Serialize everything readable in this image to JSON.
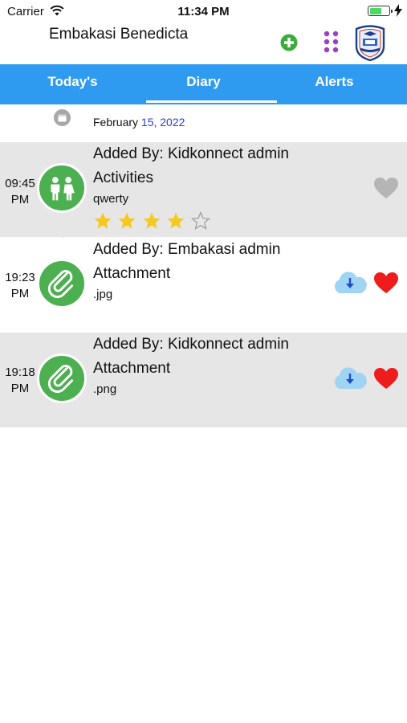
{
  "status_bar": {
    "carrier": "Carrier",
    "time": "11:34 PM"
  },
  "header": {
    "child_name": "Embakasi Benedicta"
  },
  "tabs": [
    {
      "label": "Today's",
      "selected": false
    },
    {
      "label": "Diary",
      "selected": true
    },
    {
      "label": "Alerts",
      "selected": false
    }
  ],
  "date_row": {
    "month": "February",
    "day_year": "15, 2022"
  },
  "entries": [
    {
      "time_line1": "09:45",
      "time_line2": "PM",
      "added_by": "Added By: Kidkonnect admin",
      "kind": "Activities",
      "detail": "qwerty",
      "icon": "children-icon",
      "rating": 4,
      "rating_max": 5,
      "liked": false,
      "downloadable": false
    },
    {
      "time_line1": "19:23",
      "time_line2": "PM",
      "added_by": "Added By: Embakasi admin",
      "kind": "Attachment",
      "detail": ".jpg",
      "icon": "paperclip-icon",
      "liked": true,
      "downloadable": true
    },
    {
      "time_line1": "19:18",
      "time_line2": "PM",
      "added_by": "Added By: Kidkonnect admin",
      "kind": "Attachment",
      "detail": ".png",
      "icon": "paperclip-icon",
      "liked": true,
      "downloadable": true
    }
  ],
  "colors": {
    "tab_bar": "#2f9bf0",
    "avatar_green": "#4caf50",
    "liked_heart": "#ee1c1c",
    "unliked_heart": "#b5b5b5",
    "star": "#f7c81e",
    "date_highlight": "#2a3bd1",
    "apps_dots": "#9b3fc4",
    "add_button": "#3bab3b"
  }
}
